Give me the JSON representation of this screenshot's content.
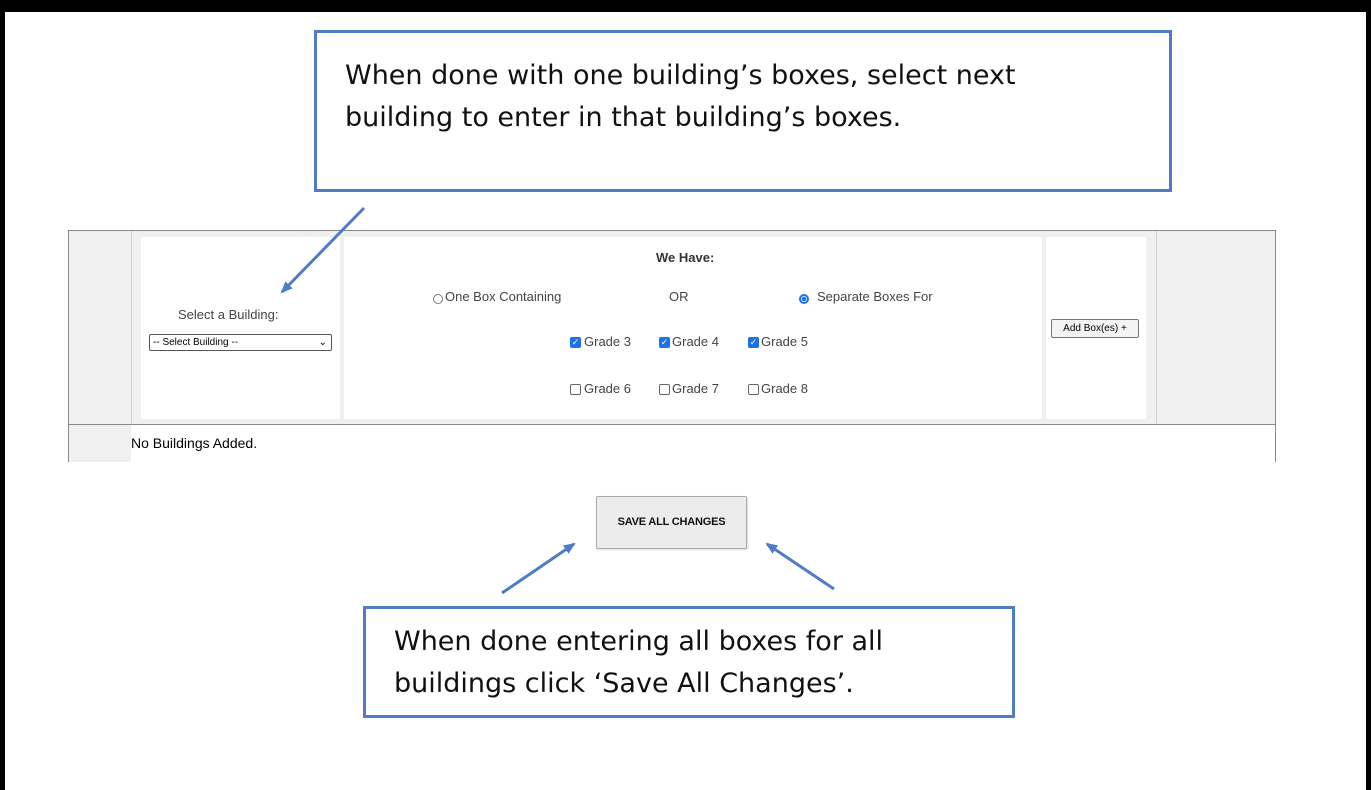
{
  "callouts": {
    "top": {
      "line1": "When done with one building’s boxes, select next",
      "line2": "building to enter in that building’s boxes."
    },
    "bottom": {
      "line1": "When done entering all boxes for all",
      "line2": "buildings click ‘Save All Changes’."
    }
  },
  "form": {
    "building_label": "Select a Building:",
    "building_select": {
      "value": "-- Select Building --"
    },
    "we_have_label": "We Have:",
    "option_one_box": {
      "label": "One Box Containing",
      "selected": false
    },
    "or_label": "OR",
    "option_separate": {
      "label": "Separate Boxes For",
      "selected": true
    },
    "grades": [
      {
        "label": "Grade 3",
        "checked": true
      },
      {
        "label": "Grade 4",
        "checked": true
      },
      {
        "label": "Grade 5",
        "checked": true
      },
      {
        "label": "Grade 6",
        "checked": false
      },
      {
        "label": "Grade 7",
        "checked": false
      },
      {
        "label": "Grade 8",
        "checked": false
      }
    ],
    "add_button_label": "Add Box(es) +",
    "empty_state": "No Buildings Added."
  },
  "save_button_label": "SAVE ALL CHANGES",
  "colors": {
    "callout_border": "#4f7bc7",
    "arrow": "#4f7bc7",
    "checkbox_accent": "#1a73e8",
    "frame": "#000000"
  }
}
